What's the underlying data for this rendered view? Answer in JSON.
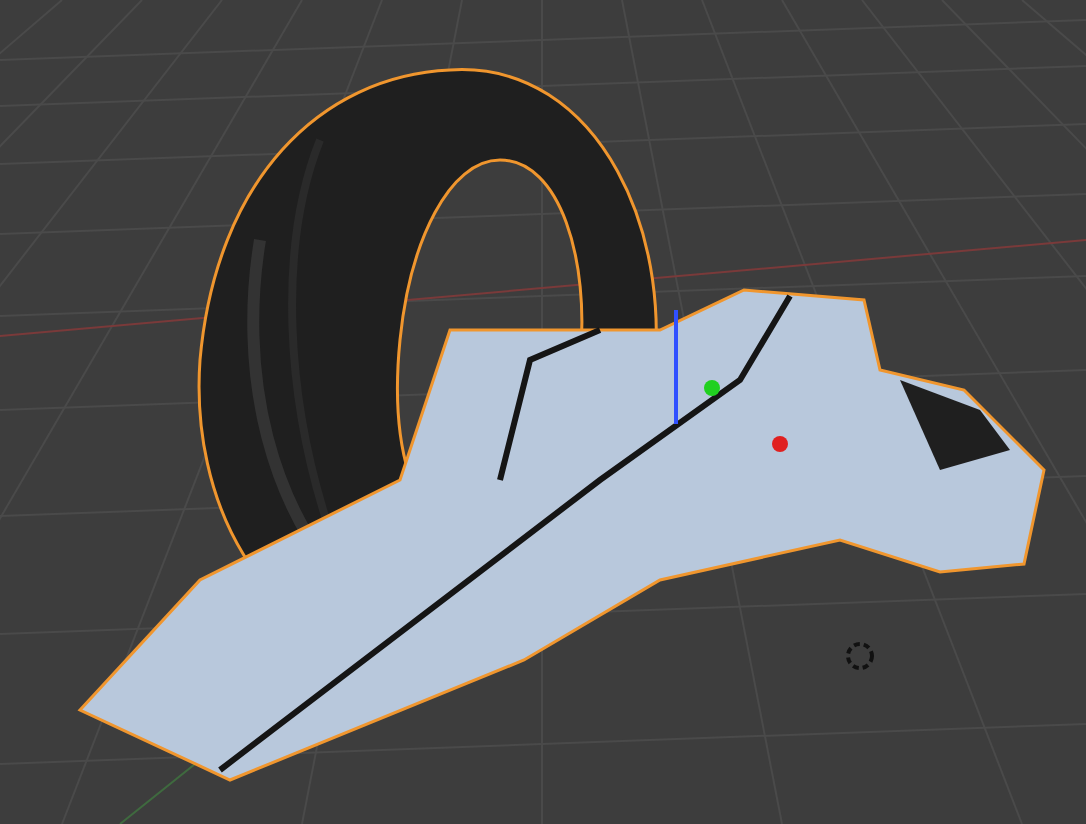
{
  "viewport": {
    "objects": [
      {
        "kind": "tire",
        "selected": true
      },
      {
        "kind": "wing",
        "selected": true
      }
    ]
  }
}
